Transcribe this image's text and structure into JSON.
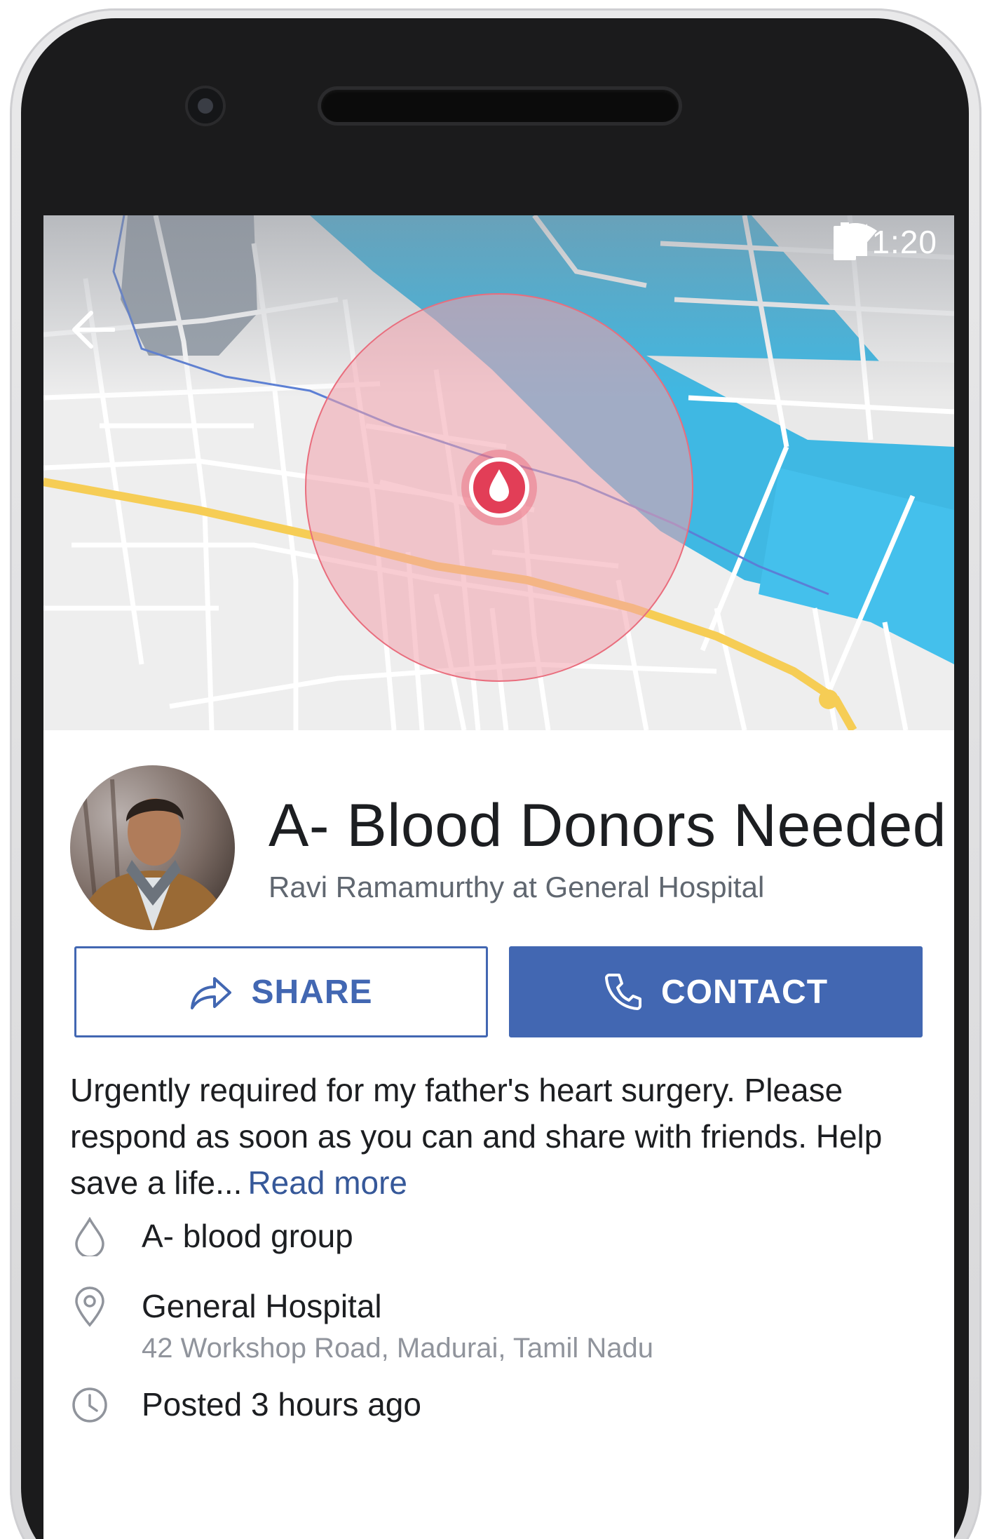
{
  "status_bar": {
    "time": "1:20",
    "icons": [
      "wifi-icon",
      "signal-icon",
      "battery-icon"
    ]
  },
  "navigation": {
    "back_icon": "arrow-left-icon"
  },
  "map": {
    "marker_icon": "blood-drop-icon",
    "colors": {
      "water": "#3fb8e3",
      "road_major": "#f6cd55",
      "radius_fill": "#f2a3ad"
    }
  },
  "request": {
    "title": "A- Blood Donors Needed",
    "subtitle": "Ravi Ramamurthy at General Hospital",
    "description": "Urgently required for my father's heart surgery. Please respond as soon as you can and share with friends. Help save a life...",
    "read_more": "Read more"
  },
  "actions": {
    "share_label": "SHARE",
    "contact_label": "CONTACT",
    "accent_color": "#4267b2"
  },
  "details": {
    "blood_group": "A- blood group",
    "location_name": "General Hospital",
    "location_address": "42 Workshop Road, Madurai, Tamil Nadu",
    "posted": "Posted 3 hours ago"
  }
}
